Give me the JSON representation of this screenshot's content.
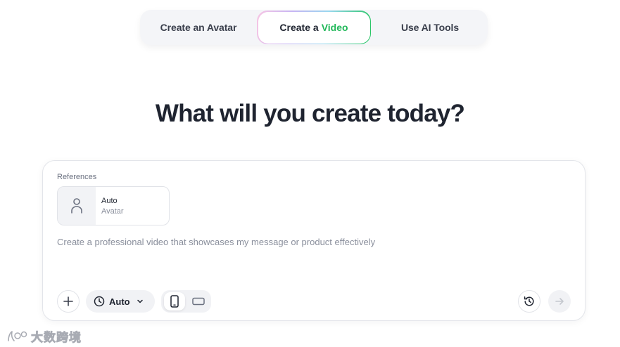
{
  "tabs": [
    {
      "label": "Create an Avatar",
      "active": false
    },
    {
      "label": "Create a",
      "accent": "Video",
      "active": true
    },
    {
      "label": "Use AI Tools",
      "active": false
    }
  ],
  "headline": "What will you create today?",
  "composer": {
    "references_label": "References",
    "reference": {
      "title": "Auto",
      "subtitle": "Avatar",
      "icon": "person-icon"
    },
    "prompt_placeholder": "Create a professional video that showcases my message or product effectively",
    "duration": {
      "value": "Auto",
      "icon": "clock-icon"
    },
    "aspect_ratio": {
      "options": [
        "portrait",
        "landscape"
      ],
      "selected": "portrait"
    }
  },
  "watermark": {
    "text": "大数跨境"
  },
  "colors": {
    "accent": "#22b85a",
    "text": "#1f2430",
    "muted": "#8a8f9c"
  }
}
